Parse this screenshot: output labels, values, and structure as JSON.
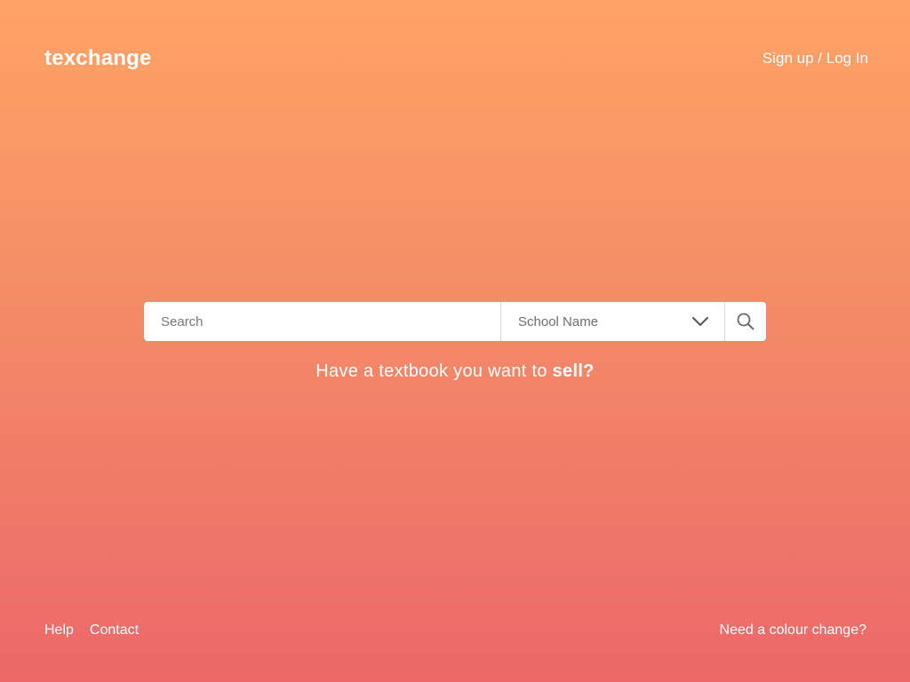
{
  "header": {
    "logo": "texchange",
    "auth_link": "Sign up / Log In"
  },
  "search": {
    "placeholder": "Search",
    "school_select": {
      "selected": "School Name",
      "icon": "chevron-down-icon"
    },
    "button_icon": "search-icon"
  },
  "sell_prompt": {
    "prefix": "Have a textbook you want to ",
    "link": "sell?"
  },
  "footer": {
    "links": [
      "Help",
      "Contact"
    ],
    "colour_change": "Need a colour change?"
  },
  "colors": {
    "gradient_top": "#ffa366",
    "gradient_bottom": "#ec686a",
    "text": "#ffffff",
    "search_bg": "#ffffff"
  }
}
